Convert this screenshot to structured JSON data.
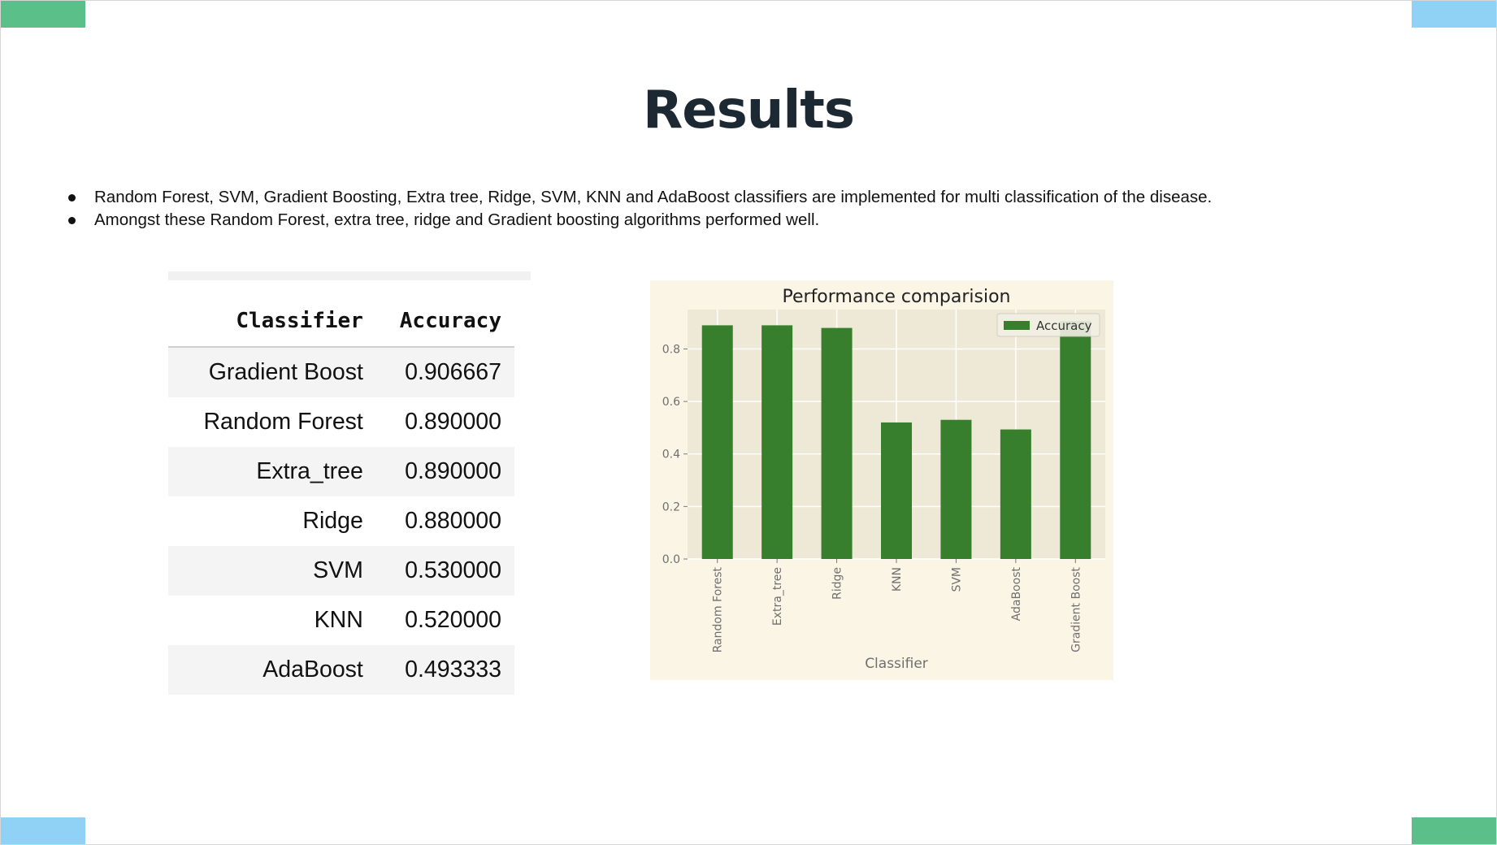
{
  "slide": {
    "title": "Results",
    "corner_colors": {
      "green": "#5bbf8a",
      "blue": "#90d2f6"
    },
    "bullets": [
      "Random Forest, SVM, Gradient Boosting, Extra tree, Ridge, SVM, KNN and AdaBoost classifiers are implemented for multi classification of the disease.",
      "Amongst these Random Forest, extra tree, ridge and Gradient boosting algorithms performed well."
    ]
  },
  "table": {
    "headers": [
      "Classifier",
      "Accuracy"
    ],
    "rows": [
      {
        "name": "Gradient Boost",
        "value": "0.906667"
      },
      {
        "name": "Random Forest",
        "value": "0.890000"
      },
      {
        "name": "Extra_tree",
        "value": "0.890000"
      },
      {
        "name": "Ridge",
        "value": "0.880000"
      },
      {
        "name": "SVM",
        "value": "0.530000"
      },
      {
        "name": "KNN",
        "value": "0.520000"
      },
      {
        "name": "AdaBoost",
        "value": "0.493333"
      }
    ]
  },
  "chart_data": {
    "type": "bar",
    "title": "Performance comparision",
    "xlabel": "Classifier",
    "ylabel": "",
    "categories": [
      "Random Forest",
      "Extra_tree",
      "Ridge",
      "KNN",
      "SVM",
      "AdaBoost",
      "Gradient Boost"
    ],
    "series": [
      {
        "name": "Accuracy",
        "values": [
          0.89,
          0.89,
          0.88,
          0.52,
          0.53,
          0.493333,
          0.906667
        ],
        "color": "#387f2d"
      }
    ],
    "yticks": [
      "0.0",
      "0.2",
      "0.4",
      "0.6",
      "0.8"
    ],
    "ylim": [
      0,
      0.95
    ],
    "grid": true,
    "legend_position": "top-right",
    "colors": {
      "plot_bg": "#eee8d6",
      "figure_bg": "#fbf5e6",
      "grid": "#ffffff"
    }
  }
}
